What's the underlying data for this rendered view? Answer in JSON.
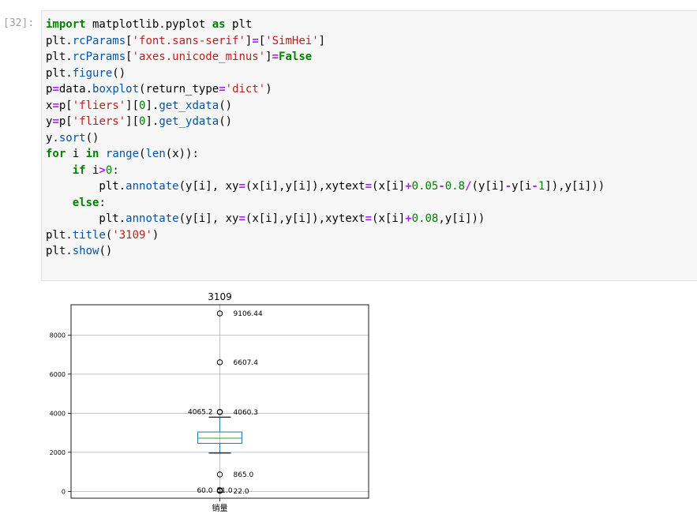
{
  "cell": {
    "prompt": "[32]:",
    "code_lines": [
      "import matplotlib.pyplot as plt",
      "plt.rcParams['font.sans-serif']=['SimHei']",
      "plt.rcParams['axes.unicode_minus']=False",
      "plt.figure()",
      "p=data.boxplot(return_type='dict')",
      "x=p['fliers'][0].get_xdata()",
      "y=p['fliers'][0].get_ydata()",
      "y.sort()",
      "for i in range(len(x)):",
      "    if i>0:",
      "        plt.annotate(y[i], xy=(x[i],y[i]),xytext=(x[i]+0.05-0.8/(y[i]-y[i-1]),y[i]))",
      "    else:",
      "        plt.annotate(y[i], xy=(x[i],y[i]),xytext=(x[i]+0.08,y[i]))",
      "plt.title('3109')",
      "plt.show()"
    ]
  },
  "chart_data": {
    "type": "box",
    "title": "3109",
    "xlabel": "",
    "ylabel": "",
    "categories": [
      "销量"
    ],
    "ylim": [
      -350,
      9550
    ],
    "yticks": [
      0,
      2000,
      4000,
      6000,
      8000
    ],
    "grid": true,
    "box": {
      "whisker_low": 1960,
      "q1": 2460,
      "median": 2720,
      "q3": 3040,
      "whisker_high": 3800
    },
    "fliers": [
      22.0,
      51.0,
      60.0,
      865.0,
      4060.3,
      4065.2,
      6607.4,
      9106.44
    ],
    "annotations": [
      {
        "text": "9106.44",
        "y": 9106.44,
        "side": "right"
      },
      {
        "text": "6607.4",
        "y": 6607.4,
        "side": "right"
      },
      {
        "text": "4065.2",
        "y": 4065.2,
        "side": "left"
      },
      {
        "text": "4060.3",
        "y": 4060.3,
        "side": "right"
      },
      {
        "text": "865.0",
        "y": 865.0,
        "side": "right"
      },
      {
        "text": "60.0",
        "y": 60.0,
        "side": "left"
      },
      {
        "text": "51.0",
        "y": 51.0,
        "side": "overlap"
      },
      {
        "text": "22.0",
        "y": 22.0,
        "side": "right"
      }
    ],
    "colors": {
      "box": "#1f77b4",
      "median": "#2ca02c",
      "whisker": "#000000",
      "grid": "#b0b0b0"
    }
  }
}
